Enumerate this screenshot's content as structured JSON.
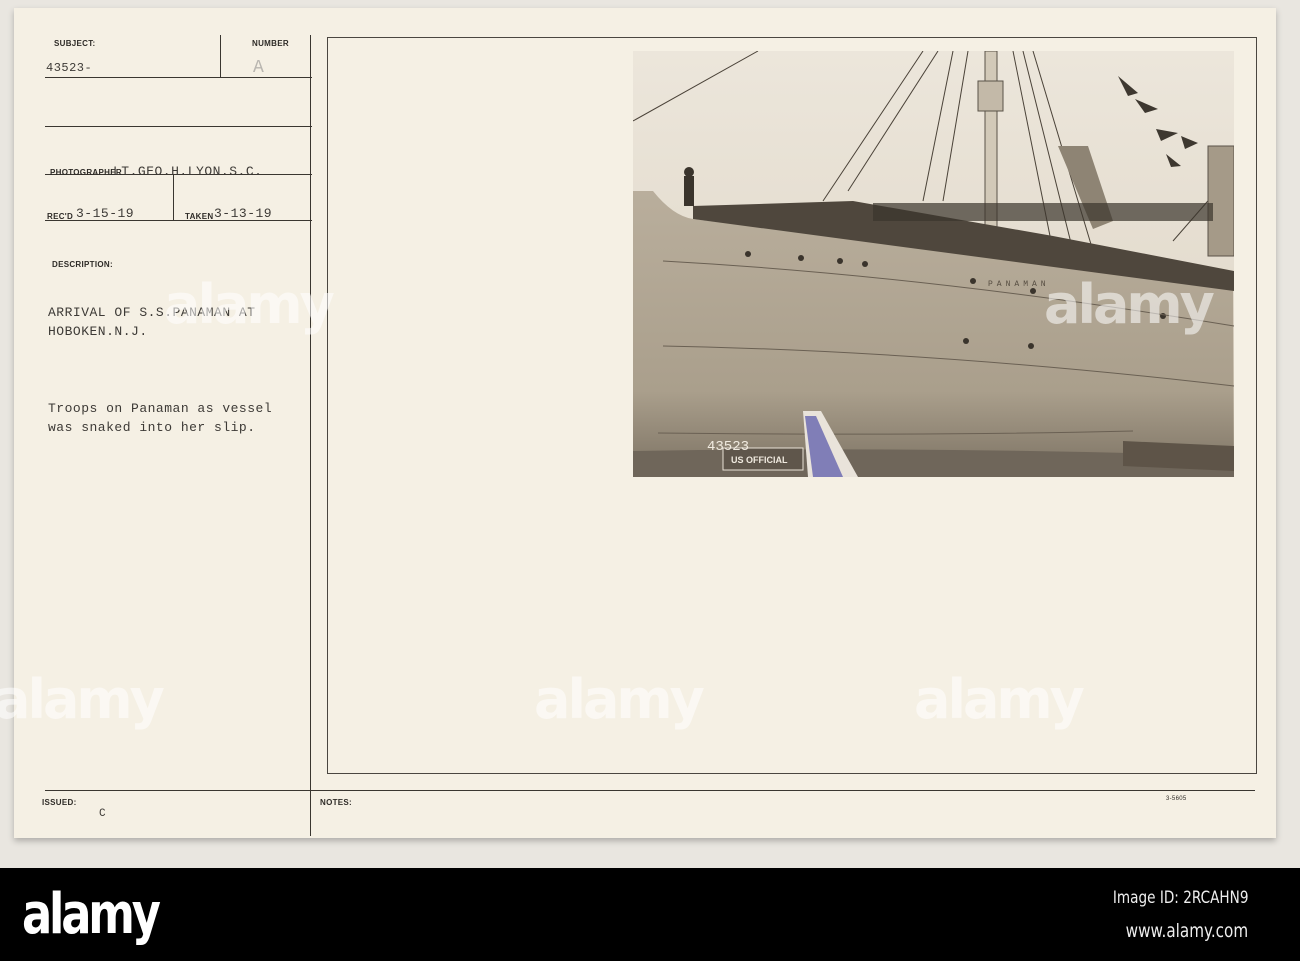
{
  "card": {
    "subject_label": "SUBJECT:",
    "subject_value": "43523-",
    "number_label": "NUMBER",
    "number_value": "A",
    "photographer_label": "PHOTOGRAPHER",
    "photographer_value": "LT.GEO.H.LYON.S.C.",
    "received_label": "REC'D",
    "received_value": "3-15-19",
    "taken_label": "TAKEN",
    "taken_value": "3-13-19",
    "description_label": "DESCRIPTION:",
    "description_title": [
      "ARRIVAL OF S.S.PANAMAN AT",
      "HOBOKEN.N.J."
    ],
    "description_text": [
      "Troops on Panaman as vessel",
      "was snaked into her slip."
    ],
    "issued_label": "ISSUED:",
    "issued_value": "C",
    "notes_label": "NOTES:",
    "form_code": "3-5605"
  },
  "photo": {
    "negative_number": "43523",
    "stamp": "US OFFICIAL",
    "ship_name": "PANAMAN"
  },
  "watermark": "alamy",
  "footer": {
    "logo": "alamy",
    "image_id": "Image ID: 2RCAHN9",
    "url": "www.alamy.com"
  }
}
